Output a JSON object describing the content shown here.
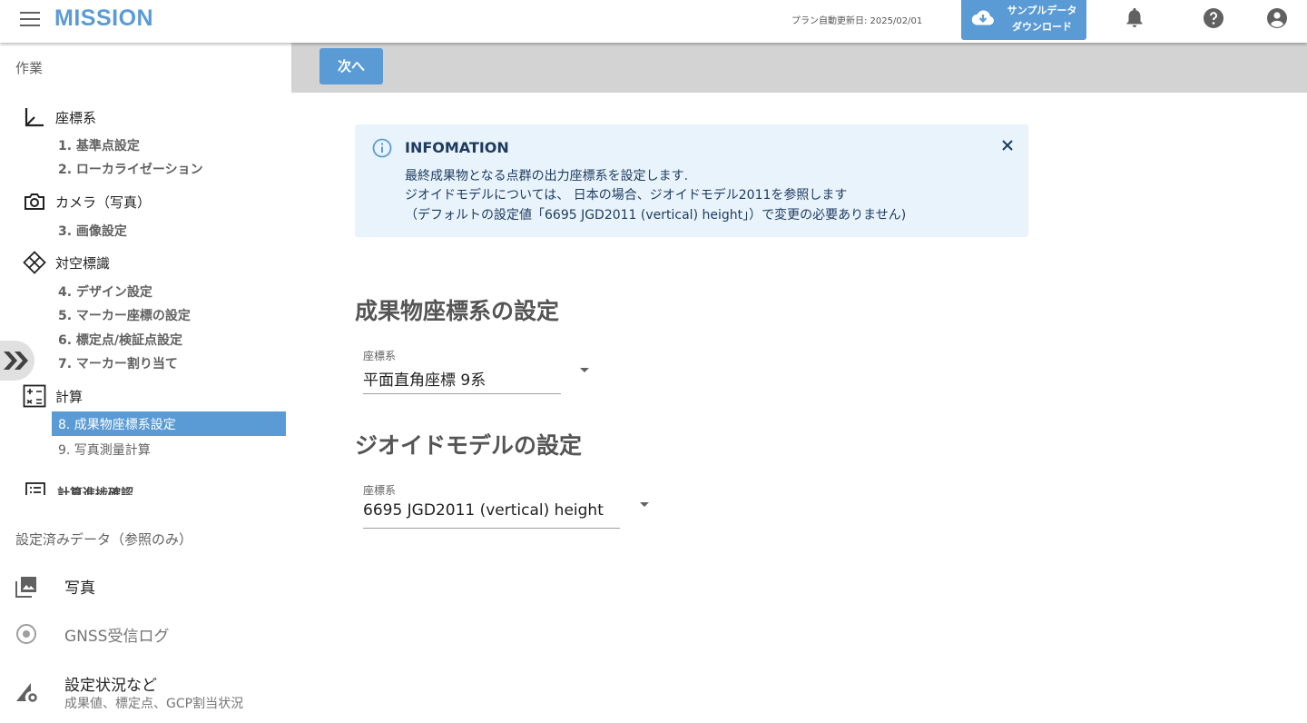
{
  "header": {
    "brand": "MISSION",
    "plan_date": "プラン自動更新日: 2025/02/01",
    "download_label": "サンプルデータ\nダウンロード"
  },
  "toolbar": {
    "next_label": "次へ"
  },
  "sidebar": {
    "section_work": "作業",
    "categories": [
      {
        "label": "座標系",
        "icon": "axis-icon"
      },
      {
        "label": "カメラ（写真）",
        "icon": "camera-icon"
      },
      {
        "label": "対空標識",
        "icon": "marker-icon"
      },
      {
        "label": "計算",
        "icon": "calculator-icon"
      },
      {
        "label": "計算進捗確認",
        "icon": "list-icon"
      }
    ],
    "steps": [
      "1. 基準点設定",
      "2. ローカライゼーション",
      "3. 画像設定",
      "4. デザイン設定",
      "5. マーカー座標の設定",
      "6. 標定点/検証点設定",
      "7. マーカー割り当て",
      "8. 成果物座標系設定",
      "9. 写真測量計算"
    ],
    "section_ref": "設定済みデータ（参照のみ）",
    "ref_items": [
      {
        "label": "写真",
        "icon": "photo-icon"
      },
      {
        "label": "GNSS受信ログ",
        "icon": "gnss-icon"
      },
      {
        "label": "設定状況など",
        "sub": "成果値、標定点、GCP割当状況",
        "icon": "settings-chart-icon"
      }
    ]
  },
  "info": {
    "title": "INFOMATION",
    "lines": [
      "最終成果物となる点群の出力座標系を設定します.",
      "ジオイドモデルについては、 日本の場合、ジオイドモデル2011を参照します",
      "（デフォルトの設定値「6695 JGD2011 (vertical) height」）で変更の必要ありません)"
    ]
  },
  "output_crs": {
    "title": "成果物座標系の設定",
    "field_label": "座標系",
    "value": "平面直角座標 9系"
  },
  "geoid": {
    "title": "ジオイドモデルの設定",
    "field_label": "座標系",
    "value": "6695 JGD2011 (vertical) height"
  },
  "colors": {
    "accent": "#5b9bd5",
    "toolbar": "#d3d3d3",
    "info_bg": "#e8f3fc"
  }
}
